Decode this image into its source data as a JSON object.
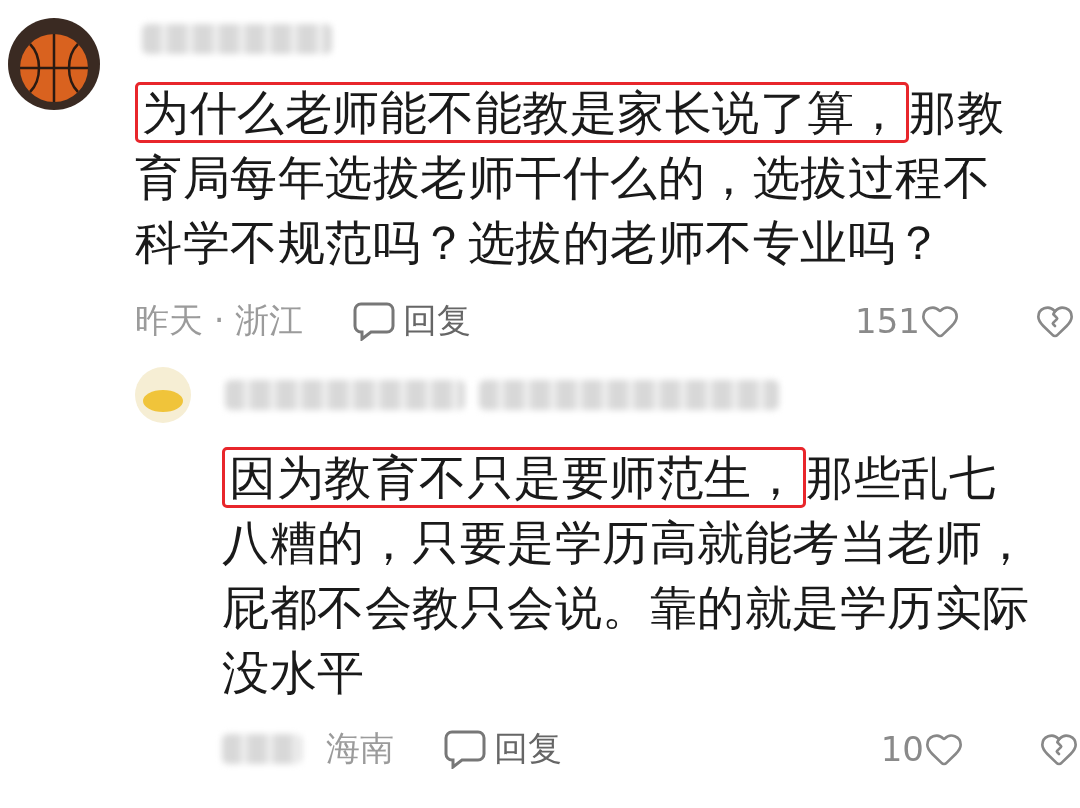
{
  "comments": [
    {
      "kind": "top",
      "highlight": "为什么老师能不能教是家长说了算，",
      "text": "那教育局每年选拔老师干什么的，选拔过程不科学不规范吗？选拔的老师不专业吗？",
      "time_location": "昨天 · 浙江",
      "reply_label": "回复",
      "likes": "151"
    },
    {
      "kind": "reply",
      "highlight": "因为教育不只是要师范生，",
      "text": "那些乱七八糟的，只要是学历高就能考当老师，屁都不会教只会说。靠的就是学历实际没水平",
      "time_location": "海南",
      "reply_label": "回复",
      "likes": "10"
    }
  ]
}
